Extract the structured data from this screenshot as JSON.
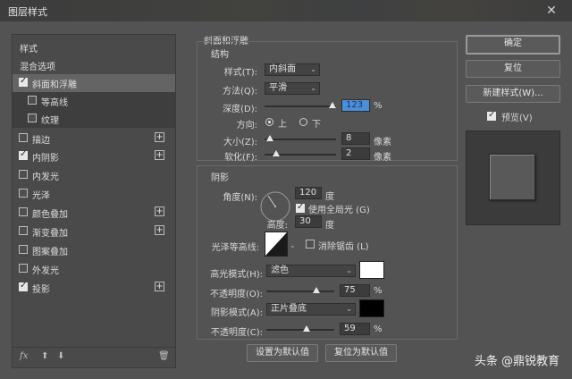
{
  "window": {
    "title": "图层样式",
    "close_glyph": "✕"
  },
  "left_panel": {
    "header": "样式",
    "blend_options": "混合选项",
    "items": [
      {
        "label": "斜面和浮雕",
        "checked": true
      },
      {
        "label": "等高线",
        "checked": false
      },
      {
        "label": "纹理",
        "checked": false
      },
      {
        "label": "描边",
        "checked": false
      },
      {
        "label": "内阴影",
        "checked": true
      },
      {
        "label": "内发光",
        "checked": false
      },
      {
        "label": "光泽",
        "checked": false
      },
      {
        "label": "颜色叠加",
        "checked": false
      },
      {
        "label": "渐变叠加",
        "checked": false
      },
      {
        "label": "图案叠加",
        "checked": false
      },
      {
        "label": "外发光",
        "checked": false
      },
      {
        "label": "投影",
        "checked": false
      }
    ],
    "footer": {
      "fx": "fx",
      "up": "⬆",
      "down": "⬇",
      "trash": "🗑"
    }
  },
  "bevel": {
    "section_title": "斜面和浮雕",
    "structure_title": "结构",
    "style_label": "样式(T):",
    "style_value": "内斜面",
    "technique_label": "方法(Q):",
    "technique_value": "平滑",
    "depth_label": "深度(D):",
    "depth_value": "123",
    "depth_unit": "%",
    "direction_label": "方向:",
    "dir_up": "上",
    "dir_down": "下",
    "size_label": "大小(Z):",
    "size_value": "8",
    "size_unit": "像素",
    "soften_label": "软化(F):",
    "soften_value": "2",
    "soften_unit": "像素"
  },
  "shading": {
    "title": "阴影",
    "angle_label": "角度(N):",
    "angle_value": "120",
    "angle_unit": "度",
    "global_light": "使用全局光 (G)",
    "altitude_label": "高度:",
    "altitude_value": "30",
    "altitude_unit": "度",
    "contour_label": "光泽等高线:",
    "antialias": "消除锯齿 (L)",
    "highlight_label": "高光模式(H):",
    "highlight_mode": "滤色",
    "highlight_color": "#ffffff",
    "hl_opacity_label": "不透明度(O):",
    "hl_opacity": "75",
    "pct": "%",
    "shadow_label": "阴影模式(A):",
    "shadow_mode": "正片叠底",
    "shadow_color": "#000000",
    "sh_opacity_label": "不透明度(C):",
    "sh_opacity": "59"
  },
  "buttons": {
    "make_default": "设置为默认值",
    "reset_default": "复位为默认值",
    "ok": "确定",
    "reset": "复位",
    "new_style": "新建样式(W)...",
    "preview": "预览(V)"
  },
  "watermark": "头条 @鼎锐教育"
}
